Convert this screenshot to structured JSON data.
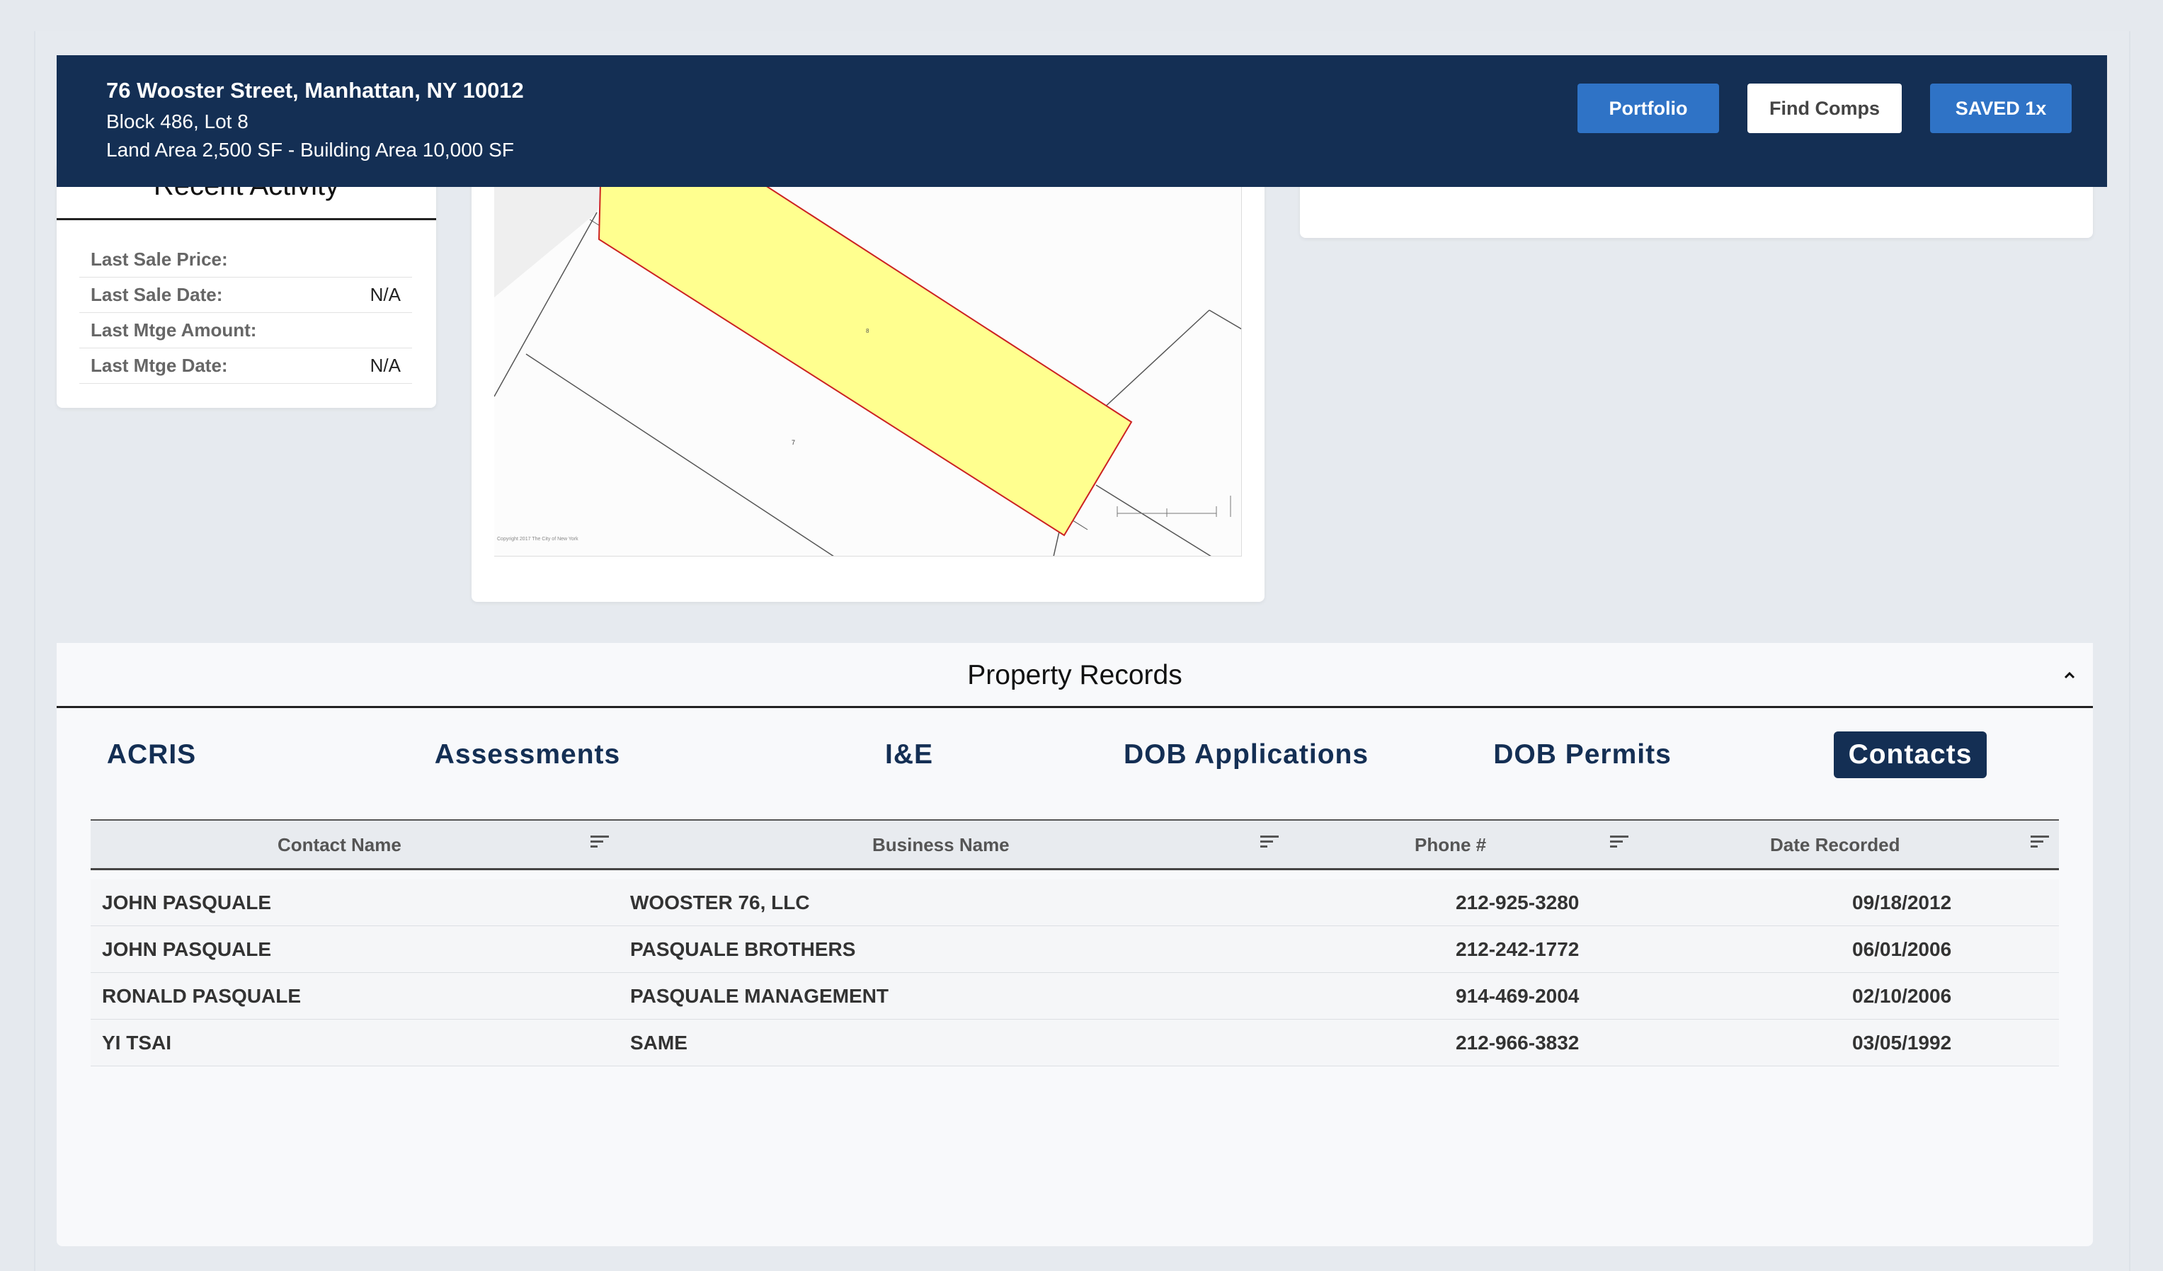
{
  "header": {
    "address": "76 Wooster Street, Manhattan, NY 10012",
    "block_lot": "Block 486, Lot 8",
    "areas": "Land Area 2,500 SF - Building Area 10,000 SF",
    "buttons": {
      "portfolio": "Portfolio",
      "find_comps": "Find Comps",
      "saved": "SAVED 1x"
    }
  },
  "activity": {
    "title": "Recent Activity",
    "rows": [
      {
        "label": "Last Sale Price:",
        "value": ""
      },
      {
        "label": "Last Sale Date:",
        "value": "N/A"
      },
      {
        "label": "Last Mtge Amount:",
        "value": ""
      },
      {
        "label": "Last Mtge Date:",
        "value": "N/A"
      }
    ]
  },
  "map": {
    "copyright": "Copyright 2017 The City of New York",
    "lot_label": "8",
    "neighbor_lot_label": "7",
    "highlight_color": "#ffff8f",
    "outline_color": "#cc2222"
  },
  "records": {
    "title": "Property Records",
    "tabs": [
      "ACRIS",
      "Assessments",
      "I&E",
      "DOB Applications",
      "DOB Permits",
      "Contacts"
    ],
    "active_tab": "Contacts",
    "columns": [
      "Contact Name",
      "Business Name",
      "Phone #",
      "Date Recorded"
    ],
    "rows": [
      {
        "contact": "JOHN PASQUALE",
        "business": "WOOSTER 76, LLC",
        "phone": "212-925-3280",
        "date": "09/18/2012"
      },
      {
        "contact": "JOHN PASQUALE",
        "business": "PASQUALE BROTHERS",
        "phone": "212-242-1772",
        "date": "06/01/2006"
      },
      {
        "contact": "RONALD PASQUALE",
        "business": "PASQUALE MANAGEMENT",
        "phone": "914-469-2004",
        "date": "02/10/2006"
      },
      {
        "contact": "YI TSAI",
        "business": "SAME",
        "phone": "212-966-3832",
        "date": "03/05/1992"
      }
    ]
  },
  "colors": {
    "navy": "#142f54",
    "button_blue": "#2f73c6"
  }
}
